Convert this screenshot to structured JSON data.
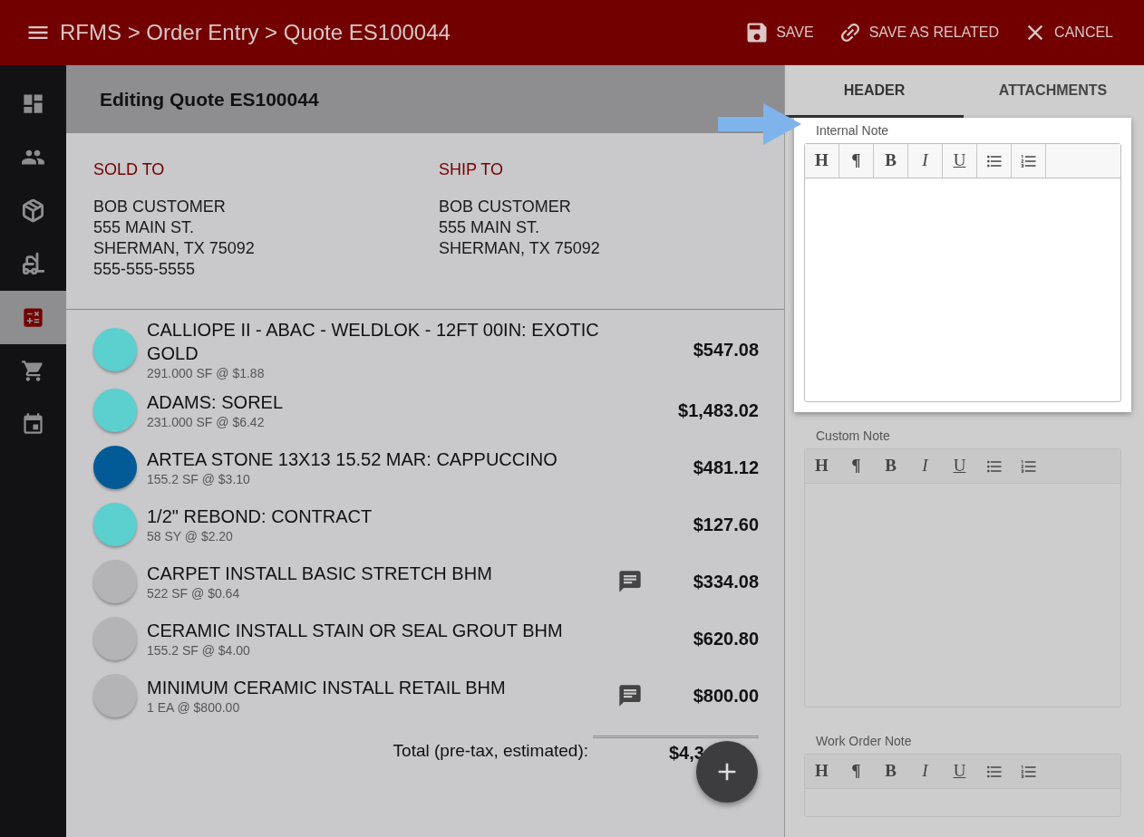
{
  "app_bar": {
    "breadcrumb": "RFMS > Order Entry > Quote ES100044",
    "actions": [
      {
        "kind": "save",
        "label": "SAVE"
      },
      {
        "kind": "link",
        "label": "SAVE AS RELATED"
      },
      {
        "kind": "cancel",
        "label": "CANCEL"
      }
    ]
  },
  "sidebar": {
    "items": [
      {
        "kind": "dashboard",
        "selected": false
      },
      {
        "kind": "people",
        "selected": false
      },
      {
        "kind": "box",
        "selected": false
      },
      {
        "kind": "forklift",
        "selected": false
      },
      {
        "kind": "calculator",
        "selected": true
      },
      {
        "kind": "cart",
        "selected": false
      },
      {
        "kind": "calendar",
        "selected": false
      }
    ]
  },
  "page_title": "Editing Quote ES100044",
  "addresses": [
    {
      "heading": "SOLD TO",
      "lines": [
        "BOB CUSTOMER",
        "555 MAIN ST.",
        "SHERMAN, TX 75092",
        "555-555-5555"
      ]
    },
    {
      "heading": "SHIP TO",
      "lines": [
        "BOB CUSTOMER",
        "555 MAIN ST.",
        "SHERMAN, TX 75092"
      ]
    }
  ],
  "line_items": [
    {
      "color": "#5ccfcf",
      "name": "CALLIOPE II - ABAC - WELDLOK - 12FT 00IN: EXOTIC GOLD",
      "detail": "291.000 SF @ $1.88",
      "has_note": false,
      "price": "$547.08"
    },
    {
      "color": "#5ccfcf",
      "name": "ADAMS: SOREL",
      "detail": "231.000 SF @ $6.42",
      "has_note": false,
      "price": "$1,483.02"
    },
    {
      "color": "#025b96",
      "name": "ARTEA STONE 13X13 15.52 MAR: CAPPUCCINO",
      "detail": "155.2 SF @ $3.10",
      "has_note": false,
      "price": "$481.12"
    },
    {
      "color": "#5ccfcf",
      "name": "1/2\" REBOND: CONTRACT",
      "detail": "58 SY @ $2.20",
      "has_note": false,
      "price": "$127.60"
    },
    {
      "color": "#b4b3b6",
      "name": "CARPET INSTALL BASIC STRETCH BHM",
      "detail": "522 SF @ $0.64",
      "has_note": true,
      "price": "$334.08"
    },
    {
      "color": "#b4b3b6",
      "name": "CERAMIC INSTALL STAIN OR SEAL GROUT BHM",
      "detail": "155.2 SF @ $4.00",
      "has_note": false,
      "price": "$620.80"
    },
    {
      "color": "#b4b3b6",
      "name": "MINIMUM CERAMIC INSTALL RETAIL BHM",
      "detail": "1 EA @ $800.00",
      "has_note": true,
      "price": "$800.00"
    }
  ],
  "total": {
    "label": "Total (pre-tax, estimated):",
    "value": "$4,3"
  },
  "tabs": [
    {
      "label": "HEADER",
      "selected": true
    },
    {
      "label": "ATTACHMENTS",
      "selected": false
    }
  ],
  "notes": [
    {
      "label": "Internal Note",
      "highlighted": true,
      "toolbar": [
        {
          "kind": "text",
          "label": "H"
        },
        {
          "kind": "text",
          "label": "¶"
        },
        {
          "kind": "bold",
          "label": "B"
        },
        {
          "kind": "italic",
          "label": "I"
        },
        {
          "kind": "underline",
          "label": "U"
        },
        {
          "kind": "bullets"
        },
        {
          "kind": "numbers"
        }
      ]
    },
    {
      "label": "Custom Note",
      "highlighted": false,
      "toolbar": [
        {
          "kind": "text",
          "label": "H"
        },
        {
          "kind": "text",
          "label": "¶"
        },
        {
          "kind": "bold",
          "label": "B"
        },
        {
          "kind": "italic",
          "label": "I"
        },
        {
          "kind": "underline",
          "label": "U"
        },
        {
          "kind": "bullets"
        },
        {
          "kind": "numbers"
        }
      ]
    },
    {
      "label": "Work Order Note",
      "highlighted": false,
      "toolbar": [
        {
          "kind": "text",
          "label": "H"
        },
        {
          "kind": "text",
          "label": "¶"
        },
        {
          "kind": "bold",
          "label": "B"
        },
        {
          "kind": "italic",
          "label": "I"
        },
        {
          "kind": "underline",
          "label": "U"
        },
        {
          "kind": "bullets"
        },
        {
          "kind": "numbers"
        }
      ]
    }
  ]
}
